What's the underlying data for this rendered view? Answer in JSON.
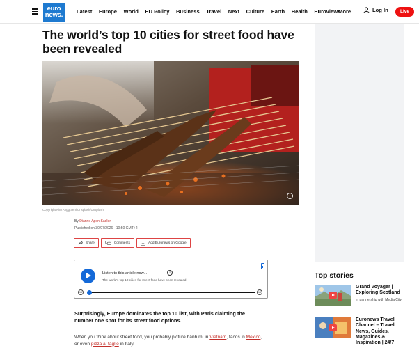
{
  "nav": {
    "logo_line1": "euro",
    "logo_line2": "news.",
    "items": [
      "Latest",
      "Europe",
      "World",
      "EU Policy",
      "Business",
      "Travel",
      "Next",
      "Culture",
      "Earth",
      "Health",
      "Euroviews"
    ],
    "more": "More",
    "login": "Log In",
    "live": "Live"
  },
  "article": {
    "headline": "The world’s top 10 cities for street food have been revealed",
    "image_credit": "Copyright Nito Anggraeni Unsplash/Unsplash",
    "by_prefix": "By",
    "author": "Dianne Apen-Sadler",
    "published": "Published on 30/07/2026 - 10:50 GMT+2",
    "share": {
      "share": "Share",
      "comments": "Comments",
      "google": "Add Euronews on Google"
    },
    "player": {
      "listen": "Listen to this article now...",
      "info": "i",
      "title": "The world's top 10 cities for street food have been revealed",
      "rewind": "15",
      "forward": "15",
      "progress": 0.01
    },
    "lead": "Surprisingly, Europe dominates the top 10 list, with Paris claiming the number one spot for its street food options.",
    "para": {
      "t1": "When you think about street food, you probably picture bánh mì in ",
      "l1": "Vietnam",
      "t2": ", tacos in ",
      "l2": "Mexico",
      "t3": ", or even ",
      "l3": "pizza al taglio",
      "t4": " in Italy."
    }
  },
  "sidebar": {
    "top_stories": "Top stories",
    "stories": [
      {
        "headline": "Grand Voyager | Exploring Scotland",
        "partner": "In partnership with Media City"
      },
      {
        "headline": "Euronews Travel Channel – Travel News, Guides, Magazines & Inspiration | 24/7",
        "partner": ""
      }
    ]
  },
  "colors": {
    "brand_blue": "#1e7ad0",
    "live_red": "#e11111",
    "link_red": "#c4302b",
    "player_blue": "#1469d8"
  }
}
